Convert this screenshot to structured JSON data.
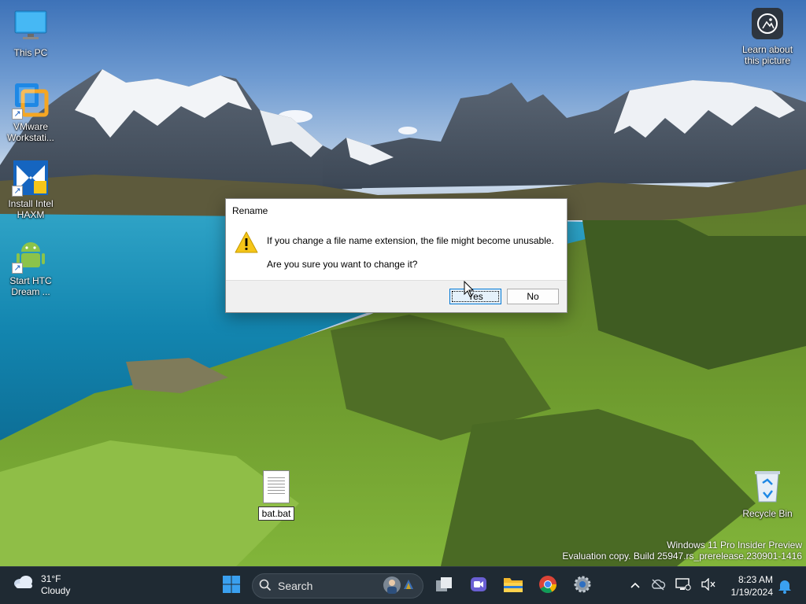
{
  "desktop": {
    "icons": [
      {
        "label": "This PC",
        "icon": "monitor-icon"
      },
      {
        "label": "VMware\nWorkstati...",
        "icon": "vmware-icon"
      },
      {
        "label": "Install Intel\nHAXM",
        "icon": "haxm-icon"
      },
      {
        "label": "Start HTC\nDream ...",
        "icon": "android-icon"
      }
    ],
    "learn_label": "Learn about this picture",
    "bat_file_label": "bat.bat",
    "recycle_label": "Recycle Bin",
    "watermark_line1": "Windows 11 Pro Insider Preview",
    "watermark_line2": "Evaluation copy. Build 25947.rs_prerelease.230901-1416"
  },
  "dialog": {
    "title": "Rename",
    "message": "If you change a file name extension, the file might become unusable.",
    "question": "Are you sure you want to change it?",
    "yes_label": "Yes",
    "no_label": "No"
  },
  "taskbar": {
    "weather_temp": "31°F",
    "weather_cond": "Cloudy",
    "search_placeholder": "Search",
    "apps": [
      "task-view-icon",
      "meet-icon",
      "file-explorer-icon",
      "chrome-icon",
      "settings-icon"
    ],
    "time": "8:23 AM",
    "date": "1/19/2024"
  },
  "colors": {
    "taskbar_bg": "#1f2a33",
    "accent": "#0078d4",
    "warning": "#f5c518"
  }
}
